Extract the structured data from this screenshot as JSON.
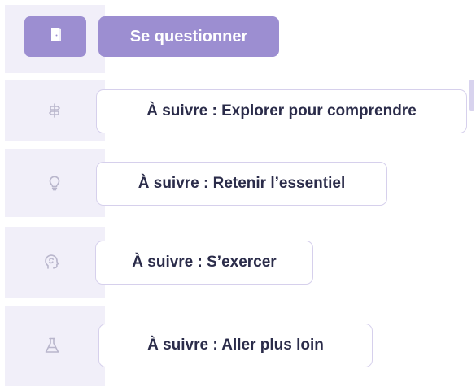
{
  "current_step": {
    "icon": "door-icon",
    "label": "Se questionner"
  },
  "steps": [
    {
      "icon": "signpost-icon",
      "label": "À suivre : Explorer pour comprendre"
    },
    {
      "icon": "lightbulb-icon",
      "label": "À suivre : Retenir l’essentiel"
    },
    {
      "icon": "brain-head-icon",
      "label": "À suivre : S’exercer"
    },
    {
      "icon": "flask-icon",
      "label": "À suivre : Aller plus loin"
    }
  ],
  "colors": {
    "accent": "#9c8ed1",
    "rail": "#f1eff9",
    "step_border": "#d6d0ec",
    "text": "#2b2c4a",
    "icon_muted": "#b9b6cc"
  }
}
